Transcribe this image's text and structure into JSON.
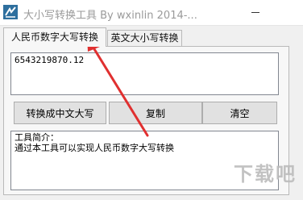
{
  "window": {
    "title": "大小写转换工具  By  wxinlin   2014-...",
    "icon": "app-logo-icon"
  },
  "tabs": [
    {
      "label": "人民币数字大写转换",
      "active": true
    },
    {
      "label": "英文大小写转换",
      "active": false
    }
  ],
  "input": {
    "value": "6543219870.12"
  },
  "buttons": {
    "convert": "转换成中文大写",
    "copy": "复制",
    "clear": "清空"
  },
  "info": {
    "heading": "工具简介：",
    "text": "通过本工具可以实现人民币数字大写转换"
  },
  "annotation": {
    "color": "#e03030"
  },
  "watermark": {
    "text": "下载吧"
  }
}
